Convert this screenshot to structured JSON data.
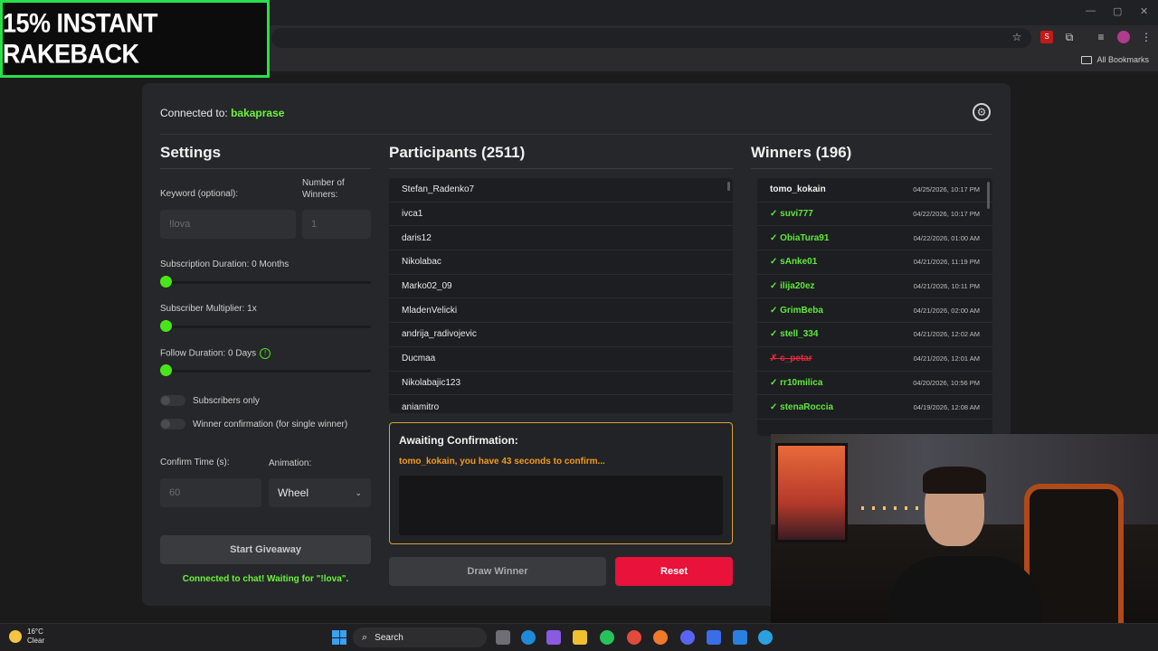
{
  "banner": {
    "text_prefix": "15% INSTANT ",
    "text_highlight": "RAKE",
    "text_suffix": "BACK"
  },
  "browser": {
    "all_bookmarks": "All Bookmarks"
  },
  "header": {
    "connected_label": "Connected to: ",
    "channel": "bakaprase"
  },
  "settings": {
    "title": "Settings",
    "keyword_label": "Keyword (optional):",
    "keyword_placeholder": "!lova",
    "num_winners_label": "Number of Winners:",
    "num_winners_placeholder": "1",
    "sub_duration_label": "Subscription Duration: 0 Months",
    "sub_multiplier_label": "Subscriber Multiplier: 1x",
    "follow_duration_label": "Follow Duration:  0  Days",
    "info_icon": "!",
    "subscribers_only_label": "Subscribers only",
    "winner_confirmation_label": "Winner confirmation (for single winner)",
    "confirm_time_label": "Confirm Time (s):",
    "confirm_time_placeholder": "60",
    "animation_label": "Animation:",
    "animation_value": "Wheel",
    "start_button": "Start Giveaway",
    "status": "Connected to chat! Waiting for \"!lova\"."
  },
  "participants": {
    "title": "Participants (2511)",
    "items": [
      "Stefan_Radenko7",
      "ivca1",
      "daris12",
      "Nikolabac",
      "Marko02_09",
      "MladenVelicki",
      "andrija_radivojevic",
      "Ducmaa",
      "Nikolabajic123",
      "aniamitro"
    ]
  },
  "awaiting": {
    "title": "Awaiting Confirmation:",
    "message": "tomo_kokain, you have 43 seconds to confirm..."
  },
  "actions": {
    "draw_winner": "Draw Winner",
    "reset": "Reset"
  },
  "winners": {
    "title": "Winners (196)",
    "items": [
      {
        "name": "tomo_kokain",
        "time": "04/25/2026, 10:17 PM",
        "state": "pending"
      },
      {
        "name": "✓ suvi777",
        "time": "04/22/2026, 10:17 PM",
        "state": "confirmed"
      },
      {
        "name": "✓ ObiaTura91",
        "time": "04/22/2026, 01:00 AM",
        "state": "confirmed"
      },
      {
        "name": "✓ sAnke01",
        "time": "04/21/2026, 11:19 PM",
        "state": "confirmed"
      },
      {
        "name": "✓ ilija20ez",
        "time": "04/21/2026, 10:11 PM",
        "state": "confirmed"
      },
      {
        "name": "✓ GrimBeba",
        "time": "04/21/2026, 02:00 AM",
        "state": "confirmed"
      },
      {
        "name": "✓ stell_334",
        "time": "04/21/2026, 12:02 AM",
        "state": "confirmed"
      },
      {
        "name": "✗ c_petar",
        "time": "04/21/2026, 12:01 AM",
        "state": "rejected"
      },
      {
        "name": "✓ rr10milica",
        "time": "04/20/2026, 10:56 PM",
        "state": "confirmed"
      },
      {
        "name": "✓ stenaRoccia",
        "time": "04/19/2026, 12:08 AM",
        "state": "confirmed"
      }
    ]
  },
  "taskbar": {
    "temp": "16°C",
    "condition": "Clear",
    "search_label": "Search"
  },
  "colors": {
    "accent": "#49e51a",
    "reset": "#e8123a",
    "await_border": "#d8a23a"
  }
}
